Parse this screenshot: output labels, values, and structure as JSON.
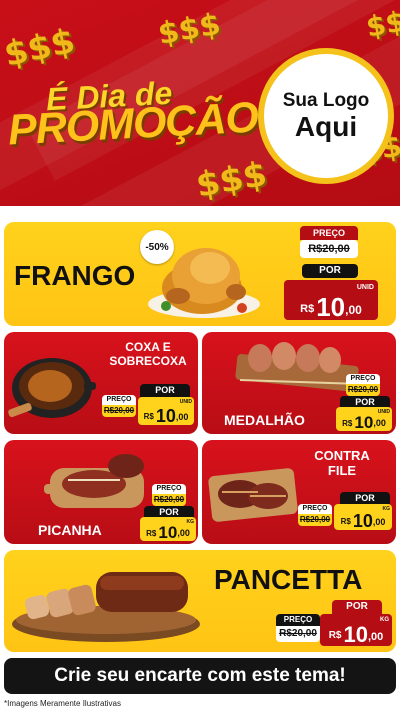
{
  "header": {
    "line1": "É Dia de",
    "line2": "PROMOÇÃO",
    "dollar_sign": "$$$",
    "logo_line1": "Sua Logo",
    "logo_line2": "Aqui"
  },
  "labels": {
    "preco": "PREÇO",
    "por": "POR",
    "currency": "R$"
  },
  "products": [
    {
      "name": "FRANGO",
      "badge": "-50%",
      "old_price": "R$20,00",
      "price_int": "10",
      "price_cents": ",00",
      "unit": "UNID"
    },
    {
      "name_line1": "COXA E",
      "name_line2": "SOBRECOXA",
      "old_price": "R$20,00",
      "price_int": "10",
      "price_cents": ",00",
      "unit": "UNID"
    },
    {
      "name": "MEDALHÃO",
      "old_price": "R$20,00",
      "price_int": "10",
      "price_cents": ",00",
      "unit": "UNID"
    },
    {
      "name": "PICANHA",
      "old_price": "R$20,00",
      "price_int": "10",
      "price_cents": ",00",
      "unit": "KG"
    },
    {
      "name_line1": "CONTRA",
      "name_line2": "FILE",
      "old_price": "R$20,00",
      "price_int": "10",
      "price_cents": ",00",
      "unit": "KG"
    },
    {
      "name": "PANCETTA",
      "old_price": "R$20,00",
      "price_int": "10",
      "price_cents": ",00",
      "unit": "KG"
    }
  ],
  "footer": {
    "cta": "Crie seu encarte com este tema!",
    "note": "*Imagens Meramente Ilustrativas"
  },
  "colors": {
    "brand_red": "#c80f18",
    "brand_yellow": "#ffd21c",
    "dark": "#141414"
  }
}
